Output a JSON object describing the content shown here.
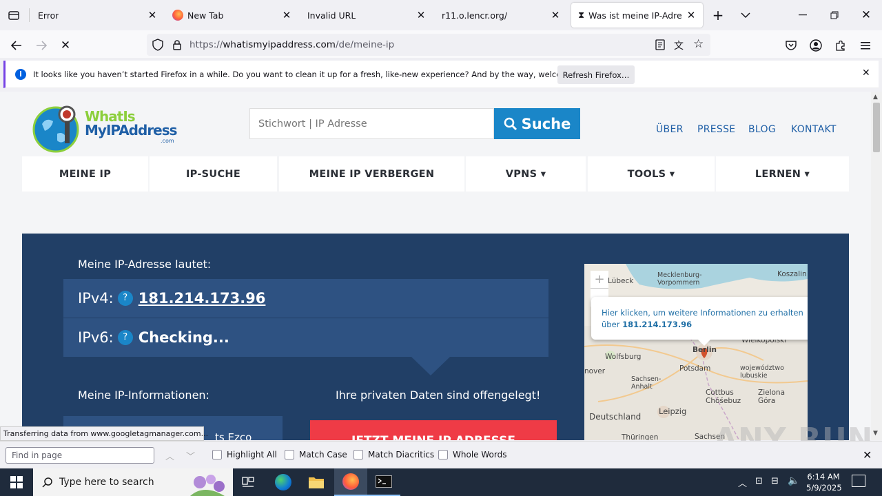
{
  "tabs": [
    {
      "label": "Error",
      "icon": "page-icon"
    },
    {
      "label": "New Tab",
      "icon": "firefox-icon"
    },
    {
      "label": "Invalid URL",
      "icon": "none"
    },
    {
      "label": "r11.o.lencr.org/",
      "icon": "none"
    },
    {
      "label": "Was ist meine IP-Adresse?",
      "icon": "hourglass-icon",
      "active": true
    }
  ],
  "url": {
    "prefix": "https://",
    "domain": "whatismyipaddress.com",
    "path": "/de/meine-ip"
  },
  "notification": {
    "text": "It looks like you haven’t started Firefox in a while. Do you want to clean it up for a fresh, like-new experience? And by the way, welcome back!",
    "button": "Refresh Firefox…"
  },
  "site": {
    "logo_line1": "WhatIs",
    "logo_line2": "MyIPAddress",
    "logo_line3": ".com",
    "search_placeholder": "Stichwort | IP Adresse",
    "search_button": "Suche",
    "top_links": [
      "ÜBER",
      "PRESSE",
      "BLOG",
      "KONTAKT"
    ],
    "nav": [
      "MEINE IP",
      "IP-SUCHE",
      "MEINE IP VERBERGEN",
      "VPNS ▾",
      "TOOLS ▾",
      "LERNEN ▾"
    ],
    "hero_title": "Meine IP-Adresse lautet:",
    "ipv4_label": "IPv4:",
    "ipv4_value": "181.214.173.96",
    "ipv6_label": "IPv6:",
    "ipv6_value": "Checking...",
    "info_title": "Meine IP-Informationen:",
    "exposed_text": "Ihre privaten Daten sind offengelegt!",
    "cta_button": "JETZT MEINE IP ADRESSE",
    "partial_text": "ts Ezco"
  },
  "map": {
    "popup_line1": "Hier klicken, um weitere Informationen zu erhalten",
    "popup_line2_prefix": "über",
    "popup_ip": "181.214.173.96",
    "labels": [
      "Lübeck",
      "Mecklenburg-Vorpommern",
      "Koszalin",
      "Wielkopolski",
      "Wolfsburg",
      "Berlin",
      "nover",
      "Potsdam",
      "województwo lubuskie",
      "Sachsen-Anhalt",
      "Cottbus Chóśebuz",
      "Zielona Góra",
      "Deutschland",
      "Leipzig",
      "Thüringen",
      "Sachsen"
    ]
  },
  "status_tip": "Transferring data from www.googletagmanager.com...",
  "findbar": {
    "placeholder": "Find in page",
    "options": [
      "Highlight All",
      "Match Case",
      "Match Diacritics",
      "Whole Words"
    ]
  },
  "taskbar": {
    "search_placeholder": "Type here to search",
    "time": "6:14 AM",
    "date": "5/9/2025"
  },
  "watermark": "ANY RUN"
}
